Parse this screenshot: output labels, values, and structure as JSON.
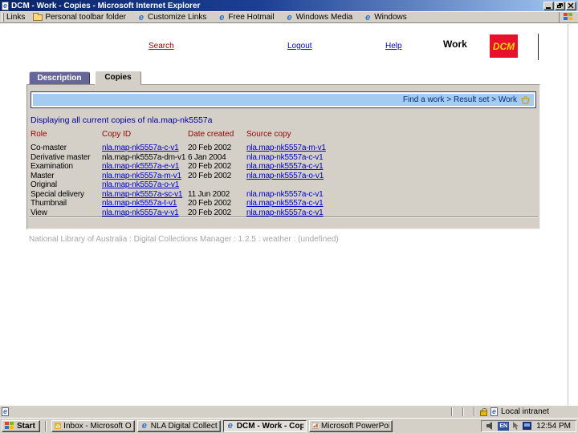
{
  "window": {
    "title": "DCM - Work - Copies - Microsoft Internet Explorer"
  },
  "links_toolbar": {
    "label": "Links",
    "items": [
      {
        "icon": "folder-icon",
        "label": "Personal toolbar folder"
      },
      {
        "icon": "ie-icon",
        "label": "Customize Links"
      },
      {
        "icon": "ie-icon",
        "label": "Free Hotmail"
      },
      {
        "icon": "ie-icon",
        "label": "Windows Media"
      },
      {
        "icon": "ie-icon",
        "label": "Windows"
      }
    ]
  },
  "header": {
    "nav": [
      {
        "label": "Search",
        "color": "#990000"
      },
      {
        "label": "Logout",
        "color": "#0000cc"
      },
      {
        "label": "Help",
        "color": "#0000cc"
      }
    ],
    "section_label": "Work",
    "logo_text": "DCM"
  },
  "tabs": [
    {
      "label": "Description",
      "active": false
    },
    {
      "label": "Copies",
      "active": true
    }
  ],
  "breadcrumb": {
    "items": [
      "Find a work",
      "Result set",
      "Work"
    ],
    "separator": ">",
    "icon": "basket-icon"
  },
  "message": "Displaying all current copies of nla.map-nk5557a",
  "copies_table": {
    "columns": [
      "Role",
      "Copy ID",
      "Date created",
      "Source copy"
    ],
    "rows": [
      {
        "role": "Co-master",
        "copy_id": "nla.map-nk5557a-c-v1",
        "copy_id_link": true,
        "date_created": "20 Feb 2002",
        "source_copy": "nla.map-nk5557a-m-v1",
        "source_underline": true
      },
      {
        "role": "Derivative master",
        "copy_id": "nla.map-nk5557a-dm-v1",
        "copy_id_link": false,
        "date_created": "6 Jan 2004",
        "source_copy": "nla.map-nk5557a-c-v1",
        "source_underline": false
      },
      {
        "role": "Examination",
        "copy_id": "nla.map-nk5557a-e-v1",
        "copy_id_link": true,
        "date_created": "20 Feb 2002",
        "source_copy": "nla.map-nk5557a-c-v1",
        "source_underline": true
      },
      {
        "role": "Master",
        "copy_id": "nla.map-nk5557a-m-v1",
        "copy_id_link": true,
        "date_created": "20 Feb 2002",
        "source_copy": "nla.map-nk5557a-o-v1",
        "source_underline": true
      },
      {
        "role": "Original",
        "copy_id": "nla.map-nk5557a-o-v1",
        "copy_id_link": true,
        "date_created": "",
        "source_copy": "",
        "source_underline": false
      },
      {
        "role": "Special delivery",
        "copy_id": "nla.map-nk5557a-sc-v1",
        "copy_id_link": true,
        "date_created": "11 Jun 2002",
        "source_copy": "nla.map-nk5557a-c-v1",
        "source_underline": false
      },
      {
        "role": "Thumbnail",
        "copy_id": "nla.map-nk5557a-t-v1",
        "copy_id_link": true,
        "date_created": "20 Feb 2002",
        "source_copy": "nla.map-nk5557a-c-v1",
        "source_underline": true
      },
      {
        "role": "View",
        "copy_id": "nla.map-nk5557a-v-v1",
        "copy_id_link": true,
        "date_created": "20 Feb 2002",
        "source_copy": "nla.map-nk5557a-c-v1",
        "source_underline": true
      }
    ]
  },
  "footer": "National Library of Australia : Digital Collections Manager : 1.2.5 : weather : (undefined)",
  "status_bar": {
    "zone": "Local intranet"
  },
  "taskbar": {
    "start_label": "Start",
    "tasks": [
      {
        "icon": "outlook-icon",
        "label": "Inbox - Microsoft Outlook",
        "active": false
      },
      {
        "icon": "ie-icon",
        "label": "NLA Digital Collections M...",
        "active": false
      },
      {
        "icon": "ie-icon",
        "label": "DCM - Work - Copies ...",
        "active": true
      },
      {
        "icon": "powerpoint-icon",
        "label": "Microsoft PowerPoint - [...",
        "active": false
      }
    ],
    "tray": {
      "language": "EN",
      "clock": "12:54 PM"
    }
  },
  "colors": {
    "titlebar_start": "#0a246a",
    "titlebar_end": "#a6caf0",
    "chrome_gray": "#d4d0c8",
    "tab_inactive_purple": "#666699",
    "breadcrumb_blue": "#a5cbf0",
    "link_blue": "#0000cc",
    "header_maroon": "#990000",
    "message_navy": "#000099",
    "logo_red": "#e8112d",
    "logo_text_yellow": "#ffd500"
  }
}
